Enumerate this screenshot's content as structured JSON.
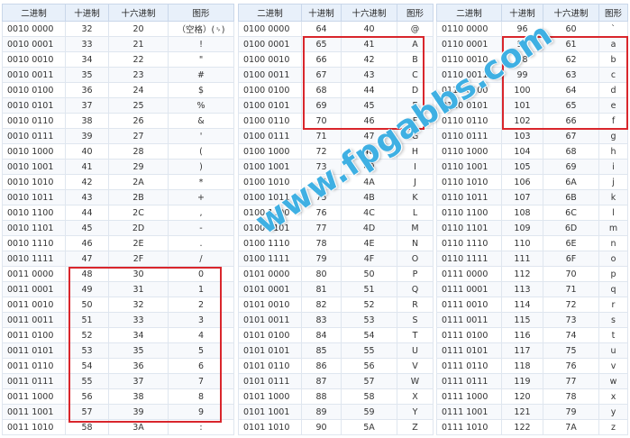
{
  "headers": [
    "二进制",
    "十进制",
    "十六进制",
    "图形"
  ],
  "tables": [
    {
      "rows": [
        [
          "0010 0000",
          "32",
          "20",
          "（空格）(␠)"
        ],
        [
          "0010 0001",
          "33",
          "21",
          "!"
        ],
        [
          "0010 0010",
          "34",
          "22",
          "\""
        ],
        [
          "0010 0011",
          "35",
          "23",
          "#"
        ],
        [
          "0010 0100",
          "36",
          "24",
          "$"
        ],
        [
          "0010 0101",
          "37",
          "25",
          "%"
        ],
        [
          "0010 0110",
          "38",
          "26",
          "&"
        ],
        [
          "0010 0111",
          "39",
          "27",
          "'"
        ],
        [
          "0010 1000",
          "40",
          "28",
          "("
        ],
        [
          "0010 1001",
          "41",
          "29",
          ")"
        ],
        [
          "0010 1010",
          "42",
          "2A",
          "*"
        ],
        [
          "0010 1011",
          "43",
          "2B",
          "+"
        ],
        [
          "0010 1100",
          "44",
          "2C",
          ","
        ],
        [
          "0010 1101",
          "45",
          "2D",
          "-"
        ],
        [
          "0010 1110",
          "46",
          "2E",
          "."
        ],
        [
          "0010 1111",
          "47",
          "2F",
          "/"
        ],
        [
          "0011 0000",
          "48",
          "30",
          "0"
        ],
        [
          "0011 0001",
          "49",
          "31",
          "1"
        ],
        [
          "0011 0010",
          "50",
          "32",
          "2"
        ],
        [
          "0011 0011",
          "51",
          "33",
          "3"
        ],
        [
          "0011 0100",
          "52",
          "34",
          "4"
        ],
        [
          "0011 0101",
          "53",
          "35",
          "5"
        ],
        [
          "0011 0110",
          "54",
          "36",
          "6"
        ],
        [
          "0011 0111",
          "55",
          "37",
          "7"
        ],
        [
          "0011 1000",
          "56",
          "38",
          "8"
        ],
        [
          "0011 1001",
          "57",
          "39",
          "9"
        ],
        [
          "0011 1010",
          "58",
          "3A",
          ":"
        ]
      ]
    },
    {
      "rows": [
        [
          "0100 0000",
          "64",
          "40",
          "@"
        ],
        [
          "0100 0001",
          "65",
          "41",
          "A"
        ],
        [
          "0100 0010",
          "66",
          "42",
          "B"
        ],
        [
          "0100 0011",
          "67",
          "43",
          "C"
        ],
        [
          "0100 0100",
          "68",
          "44",
          "D"
        ],
        [
          "0100 0101",
          "69",
          "45",
          "E"
        ],
        [
          "0100 0110",
          "70",
          "46",
          "F"
        ],
        [
          "0100 0111",
          "71",
          "47",
          "G"
        ],
        [
          "0100 1000",
          "72",
          "48",
          "H"
        ],
        [
          "0100 1001",
          "73",
          "49",
          "I"
        ],
        [
          "0100 1010",
          "74",
          "4A",
          "J"
        ],
        [
          "0100 1011",
          "75",
          "4B",
          "K"
        ],
        [
          "0100 1100",
          "76",
          "4C",
          "L"
        ],
        [
          "0100 1101",
          "77",
          "4D",
          "M"
        ],
        [
          "0100 1110",
          "78",
          "4E",
          "N"
        ],
        [
          "0100 1111",
          "79",
          "4F",
          "O"
        ],
        [
          "0101 0000",
          "80",
          "50",
          "P"
        ],
        [
          "0101 0001",
          "81",
          "51",
          "Q"
        ],
        [
          "0101 0010",
          "82",
          "52",
          "R"
        ],
        [
          "0101 0011",
          "83",
          "53",
          "S"
        ],
        [
          "0101 0100",
          "84",
          "54",
          "T"
        ],
        [
          "0101 0101",
          "85",
          "55",
          "U"
        ],
        [
          "0101 0110",
          "86",
          "56",
          "V"
        ],
        [
          "0101 0111",
          "87",
          "57",
          "W"
        ],
        [
          "0101 1000",
          "88",
          "58",
          "X"
        ],
        [
          "0101 1001",
          "89",
          "59",
          "Y"
        ],
        [
          "0101 1010",
          "90",
          "5A",
          "Z"
        ]
      ]
    },
    {
      "rows": [
        [
          "0110 0000",
          "96",
          "60",
          "`"
        ],
        [
          "0110 0001",
          "97",
          "61",
          "a"
        ],
        [
          "0110 0010",
          "98",
          "62",
          "b"
        ],
        [
          "0110 0011",
          "99",
          "63",
          "c"
        ],
        [
          "0110 0100",
          "100",
          "64",
          "d"
        ],
        [
          "0110 0101",
          "101",
          "65",
          "e"
        ],
        [
          "0110 0110",
          "102",
          "66",
          "f"
        ],
        [
          "0110 0111",
          "103",
          "67",
          "g"
        ],
        [
          "0110 1000",
          "104",
          "68",
          "h"
        ],
        [
          "0110 1001",
          "105",
          "69",
          "i"
        ],
        [
          "0110 1010",
          "106",
          "6A",
          "j"
        ],
        [
          "0110 1011",
          "107",
          "6B",
          "k"
        ],
        [
          "0110 1100",
          "108",
          "6C",
          "l"
        ],
        [
          "0110 1101",
          "109",
          "6D",
          "m"
        ],
        [
          "0110 1110",
          "110",
          "6E",
          "n"
        ],
        [
          "0110 1111",
          "111",
          "6F",
          "o"
        ],
        [
          "0111 0000",
          "112",
          "70",
          "p"
        ],
        [
          "0111 0001",
          "113",
          "71",
          "q"
        ],
        [
          "0111 0010",
          "114",
          "72",
          "r"
        ],
        [
          "0111 0011",
          "115",
          "73",
          "s"
        ],
        [
          "0111 0100",
          "116",
          "74",
          "t"
        ],
        [
          "0111 0101",
          "117",
          "75",
          "u"
        ],
        [
          "0111 0110",
          "118",
          "76",
          "v"
        ],
        [
          "0111 0111",
          "119",
          "77",
          "w"
        ],
        [
          "0111 1000",
          "120",
          "78",
          "x"
        ],
        [
          "0111 1001",
          "121",
          "79",
          "y"
        ],
        [
          "0111 1010",
          "122",
          "7A",
          "z"
        ]
      ]
    }
  ],
  "watermark": "www.fpgabbs.com",
  "highlight_color": "#d9262c"
}
